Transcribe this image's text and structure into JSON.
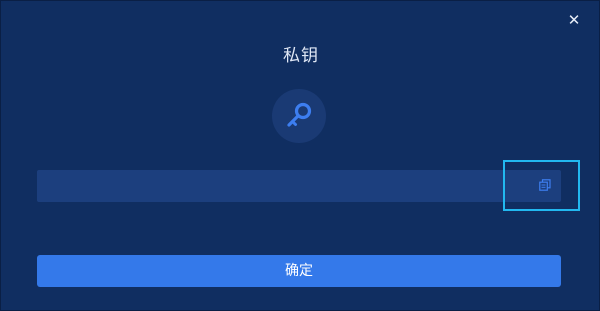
{
  "dialog": {
    "title": "私钥",
    "close_icon": "close-icon",
    "key_icon": "key-icon",
    "private_key_value": "",
    "copy_icon": "copy-icon",
    "confirm_label": "确定"
  },
  "colors": {
    "background": "#102e61",
    "field": "#1c3f7e",
    "accent": "#3479ea",
    "icon_blue": "#3d7ef0",
    "highlight": "#22b8f0"
  }
}
